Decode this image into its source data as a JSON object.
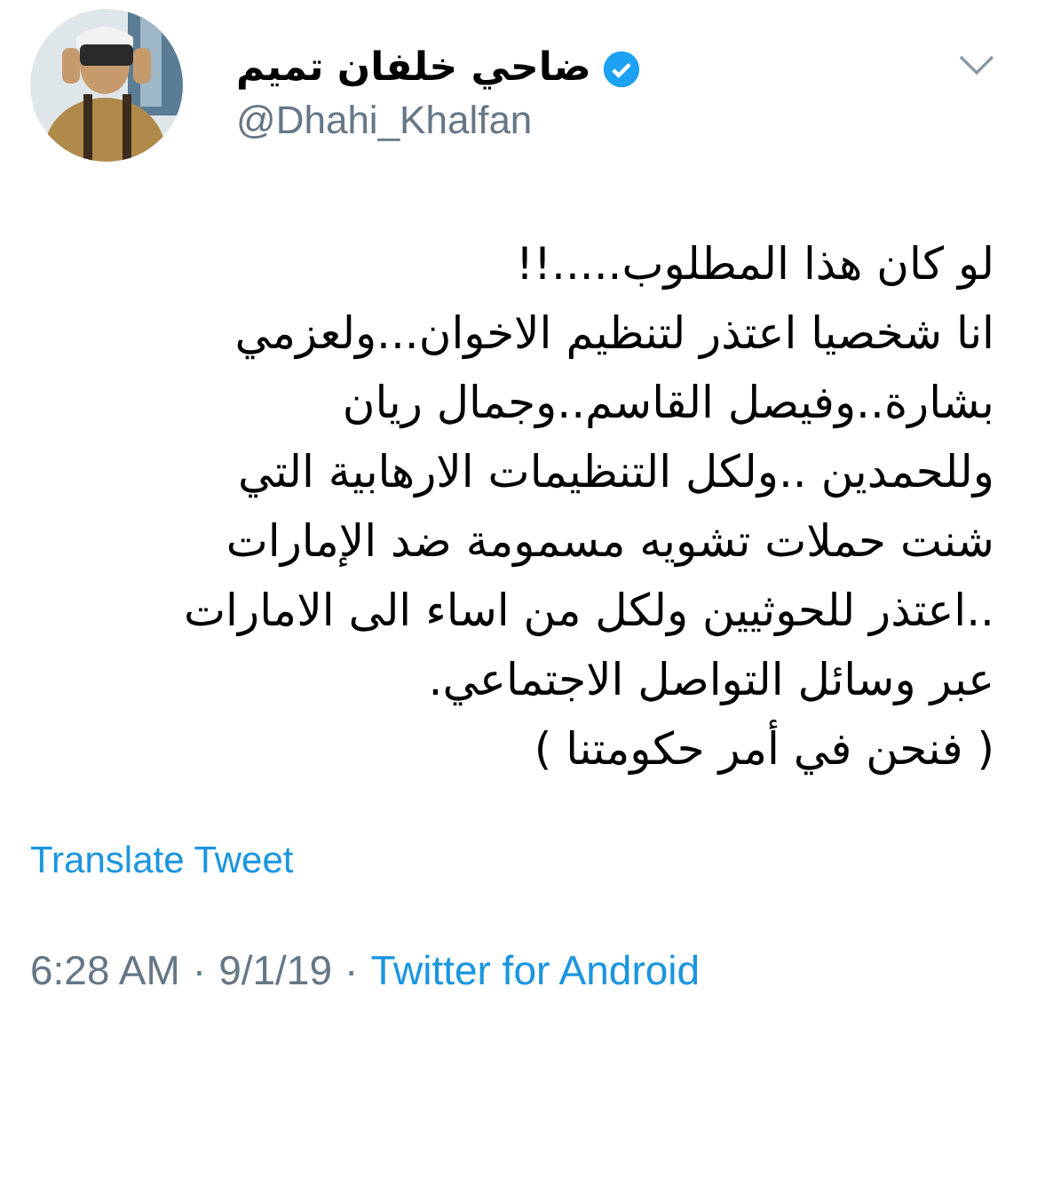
{
  "author": {
    "name": "ضاحي خلفان تميم",
    "verified": true,
    "handle": "@Dhahi_Khalfan"
  },
  "tweet": {
    "lines": [
      "لو كان هذا المطلوب.....!!",
      "انا شخصيا اعتذر لتنظيم الاخوان...ولعزمي",
      "بشارة..وفيصل القاسم..وجمال ريان",
      "وللحمدين ..ولكل التنظيمات الارهابية التي",
      "شنت حملات تشويه مسمومة ضد الإمارات",
      "..اعتذر للحوثيين ولكل من اساء الى الامارات",
      "عبر وسائل التواصل الاجتماعي.",
      "( فنحن في أمر حكومتنا )"
    ]
  },
  "translate": "Translate Tweet",
  "meta": {
    "time": "6:28 AM",
    "separator_1": "·",
    "date": "9/1/19",
    "separator_2": "·",
    "source": "Twitter for Android"
  }
}
